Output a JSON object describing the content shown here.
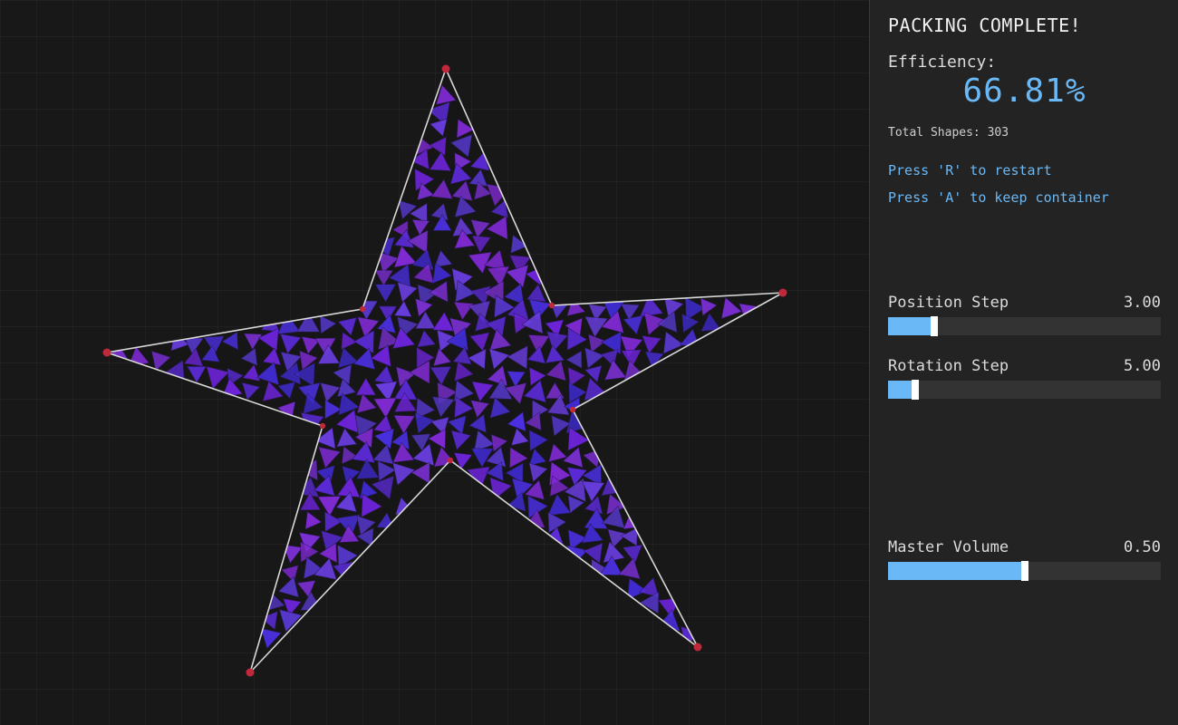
{
  "panel": {
    "status": "PACKING COMPLETE!",
    "efficiency_label": "Efficiency:",
    "efficiency_value": "66.81%",
    "total_shapes": "Total Shapes: 303",
    "hint_restart": "Press 'R' to restart",
    "hint_keep": "Press 'A' to keep container"
  },
  "sliders": {
    "position_step": {
      "label": "Position Step",
      "value": "3.00",
      "fill": 0.17
    },
    "rotation_step": {
      "label": "Rotation Step",
      "value": "5.00",
      "fill": 0.1
    },
    "master_volume": {
      "label": "Master Volume",
      "value": "0.50",
      "fill": 0.5
    }
  },
  "colors": {
    "accent": "#6ab8f5",
    "vertex": "#c0283c",
    "outline": "#d8d8d8",
    "shape_palette": [
      "#5b2bd6",
      "#6d24d8",
      "#4a30e0",
      "#7a2fd0",
      "#5538c8",
      "#3f2bd0",
      "#6a3ee0",
      "#812ad4"
    ]
  }
}
